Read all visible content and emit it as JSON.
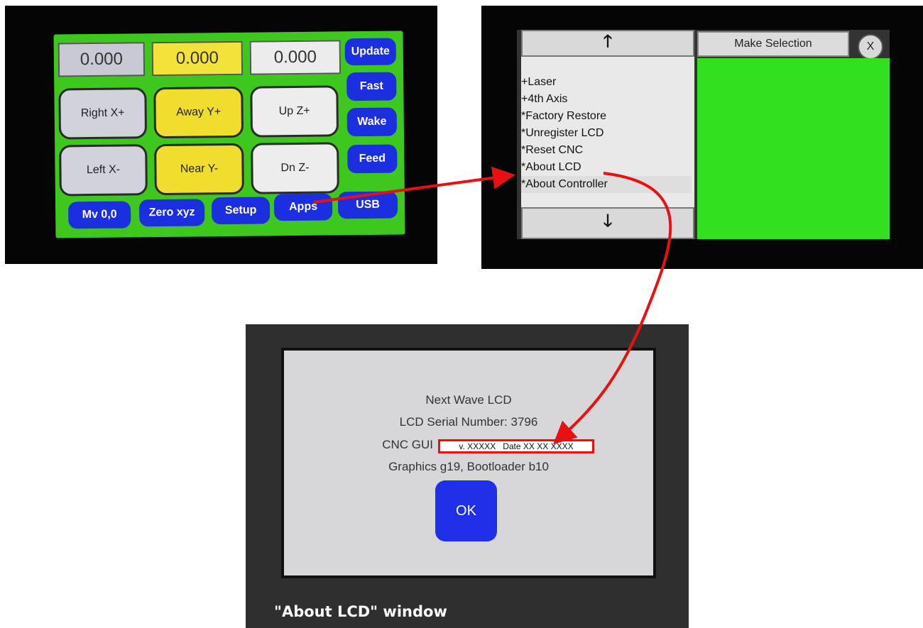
{
  "jog_screen": {
    "readouts": [
      "0.000",
      "0.000",
      "0.000"
    ],
    "jog_buttons": {
      "right_x": "Right X+",
      "away_y": "Away Y+",
      "up_z": "Up Z+",
      "left_x": "Left X-",
      "near_y": "Near Y-",
      "dn_z": "Dn Z-"
    },
    "side_buttons": [
      "Update",
      "Fast",
      "Wake",
      "Feed"
    ],
    "bottom_buttons": [
      "Mv 0,0",
      "Zero xyz",
      "Setup",
      "Apps",
      "USB"
    ]
  },
  "menu_screen": {
    "up_arrow": "🡑",
    "down_arrow": "🡓",
    "items": [
      "+Laser",
      "+4th Axis",
      "*Factory Restore",
      "*Unregister LCD",
      "*Reset CNC",
      "*About LCD",
      "*About Controller"
    ],
    "make_selection": "Make Selection",
    "close_label": "X"
  },
  "about_window": {
    "title_line": "Next Wave LCD",
    "serial_line": "LCD Serial Number: 3796",
    "gui_label": "CNC GUI",
    "gui_version": "v. XXXXX   Date XX XX XXXX",
    "graphics_line": "Graphics g19, Bootloader b10",
    "ok_label": "OK",
    "caption": "\"About LCD\" window"
  },
  "colors": {
    "screen_green": "#3ec81e",
    "menu_green": "#33e020",
    "button_blue": "#1b2fe0",
    "yellow": "#f0e020",
    "arrow_red": "#e81010"
  }
}
